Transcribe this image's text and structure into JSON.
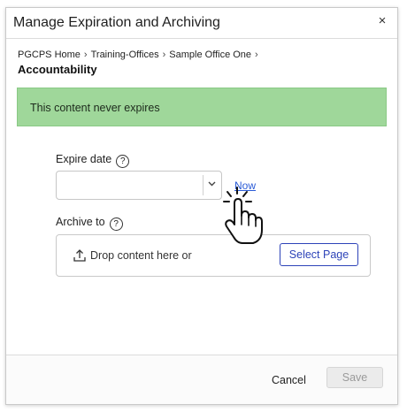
{
  "dialog": {
    "title": "Manage Expiration and Archiving",
    "close_glyph": "×"
  },
  "breadcrumb": {
    "items": [
      "PGCPS Home",
      "Training-Offices",
      "Sample Office One"
    ],
    "separator": "›",
    "current": "Accountability"
  },
  "notice": {
    "text": "This content never expires",
    "color": "#9fd79a"
  },
  "expire": {
    "label": "Expire date",
    "help_glyph": "?",
    "value": "",
    "now_link": "Now"
  },
  "archive": {
    "label": "Archive to",
    "help_glyph": "?",
    "drop_text": "Drop content here or",
    "select_button": "Select Page"
  },
  "footer": {
    "cancel": "Cancel",
    "save": "Save"
  },
  "colors": {
    "accent": "#2d43b8",
    "link": "#2a5bd7",
    "disabled_bg": "#ebebeb"
  },
  "icons": {
    "close": "close-icon",
    "help": "help-circle-icon",
    "chevron": "chevron-down-icon",
    "upload": "upload-icon",
    "cursor": "hand-pointer-cursor-icon"
  }
}
